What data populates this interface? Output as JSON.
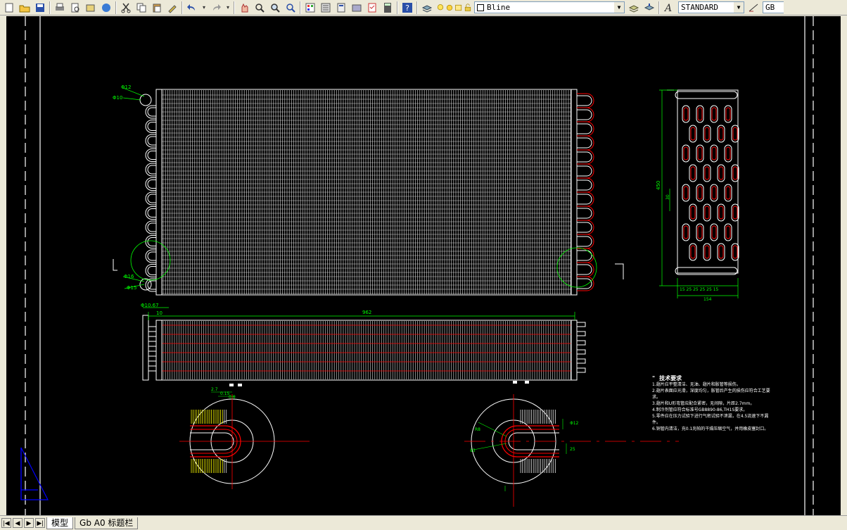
{
  "toolbar": {
    "layer_name": "Bline",
    "text_style": "STANDARD",
    "dim_style_short": "GB"
  },
  "tabs": [
    {
      "label": "模型"
    },
    {
      "label": "Gb A0 标题栏"
    }
  ],
  "dimensions": {
    "phi_top1": "Φ12",
    "phi_top2": "Φ10",
    "phi_bot1": "Φ16",
    "phi_bot2": "Φ15",
    "phi_side": "Φ10.67",
    "len_10": "10",
    "len_total": "962",
    "height_right": "450",
    "right_30": "30",
    "bottom_dims": "15 25 25 25 25 15",
    "bottom_total": "154"
  },
  "tech_notes": {
    "title": "技术要求",
    "lines": [
      "1.翅片应平整清洁、无油、翅片和胀管等损伤。",
      "2.翅片表面应光滑，深度均匀，胀管后产生的损伤应符合工艺要",
      "求。",
      "3.翅片和U形弯管应配合紧密，无间隙，片距2.7mm。",
      "4.制冷剂管应符合标准号GB8890-86,TH1S要求。",
      "5.零件应在压力试验下进行气密试验不泄漏，在4.5流速下不漏",
      "件。",
      "6.铜管内清洁，充0.1兆帕的干燥压缩空气，并用橡皮塞封口。"
    ]
  },
  "colors": {
    "canvas": "#000000",
    "fins": "#ffffff",
    "tubes_red": "#ff0000",
    "dims_green": "#00ff00",
    "highlight_yellow": "#ffff00",
    "ucs_blue": "#0000ff"
  }
}
